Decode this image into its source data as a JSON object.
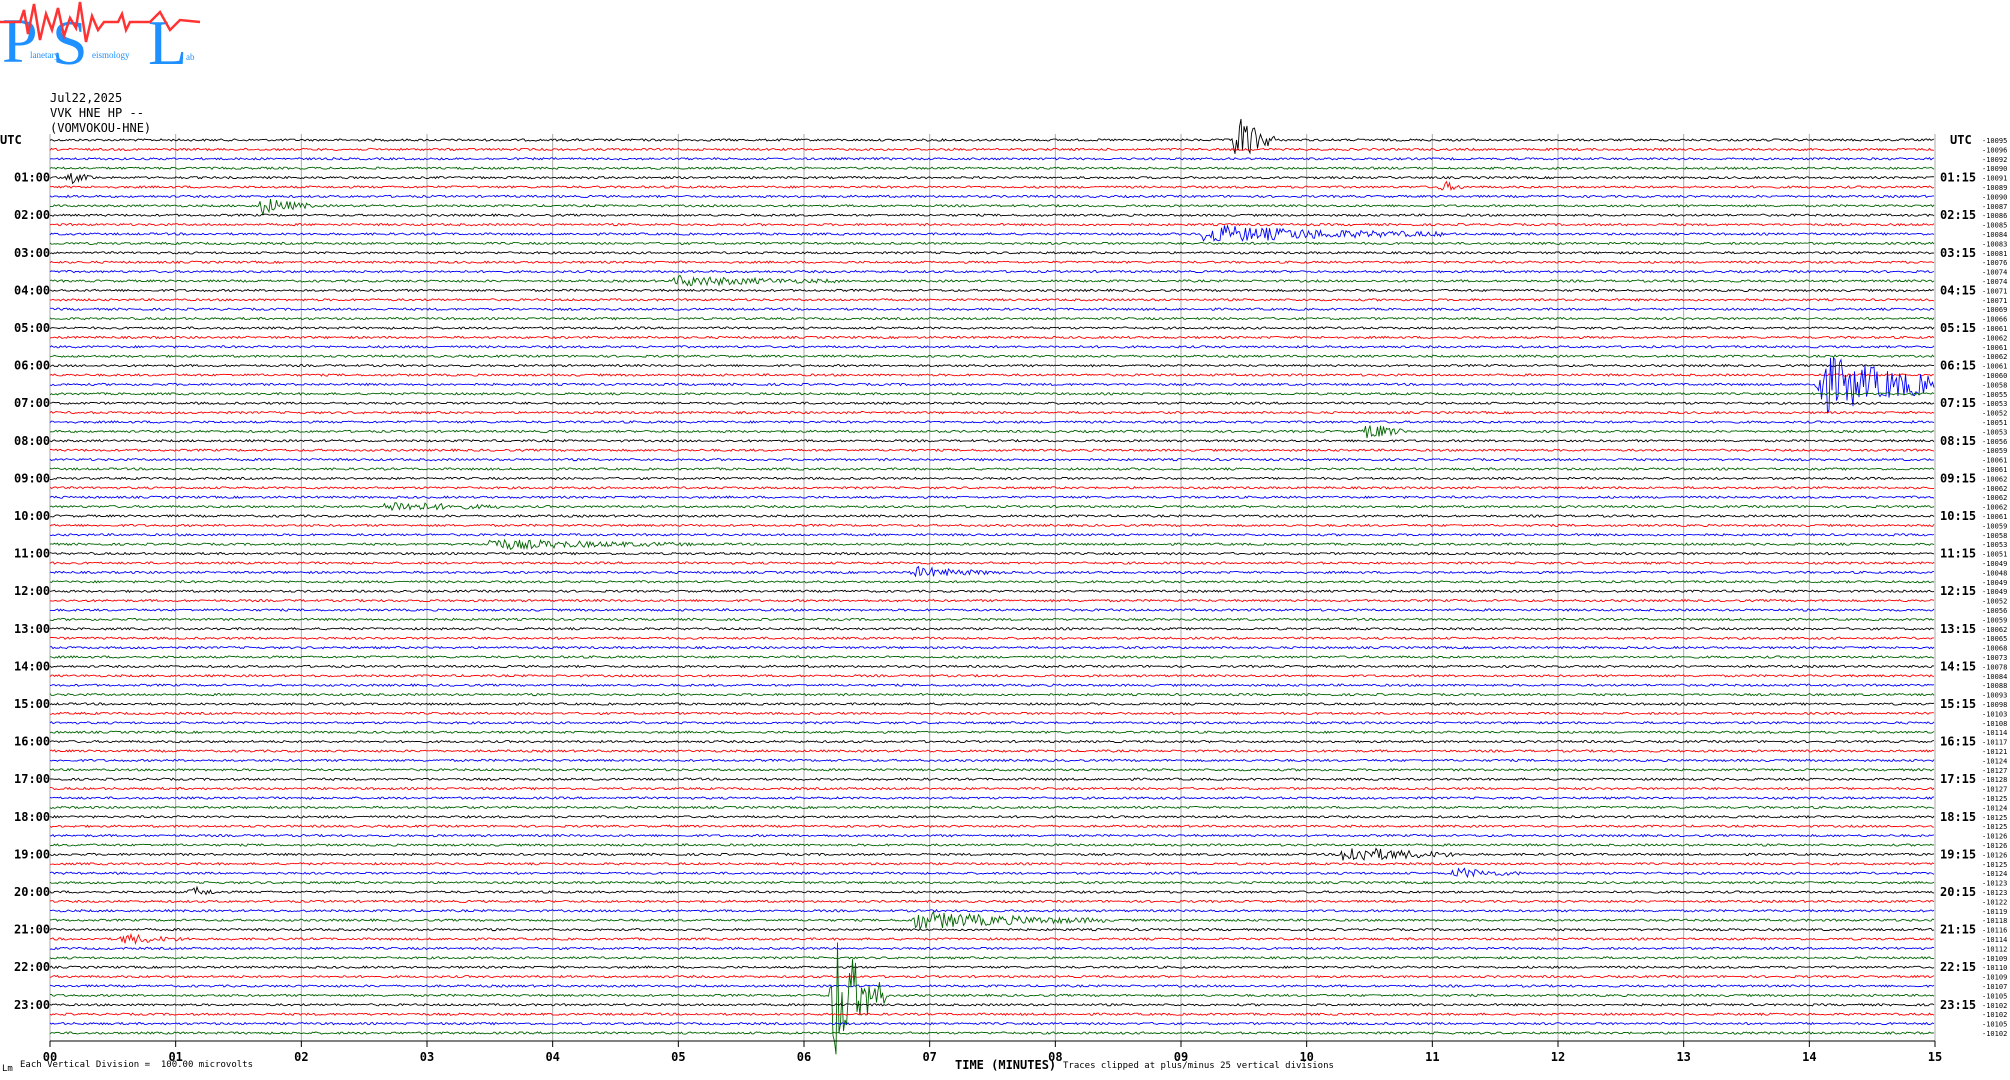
{
  "logo": {
    "letters": [
      "P",
      "S",
      "L"
    ],
    "words": [
      "lanetary",
      "eismology",
      "ab"
    ]
  },
  "header": {
    "date": "Jul22,2025",
    "station": "VVK HNE HP --",
    "channel": "(VOMVOKOU-HNE)"
  },
  "footer": {
    "corner_mark": "Lm",
    "division_note": "Each Vertical Division =  100.00 microvolts",
    "xlabel": "TIME (MINUTES)",
    "clip_note": "Traces clipped at plus/minus 25 vertical divisions"
  },
  "colors": {
    "series": [
      "#000000",
      "#ff0000",
      "#0000ff",
      "#006400"
    ],
    "grid": "#a9a9a9"
  },
  "chart_data": {
    "type": "line",
    "description_free": true,
    "xlabel": "TIME (MINUTES)",
    "x_ticks": [
      "00",
      "01",
      "02",
      "03",
      "04",
      "05",
      "06",
      "07",
      "08",
      "09",
      "10",
      "11",
      "12",
      "13",
      "14",
      "15"
    ],
    "xlim": [
      0,
      15
    ],
    "left_tz": "UTC",
    "right_tz": "UTC",
    "left_labels": [
      "01:00",
      "02:00",
      "03:00",
      "04:00",
      "05:00",
      "06:00",
      "07:00",
      "08:00",
      "09:00",
      "10:00",
      "11:00",
      "12:00",
      "13:00",
      "14:00",
      "15:00",
      "16:00",
      "17:00",
      "18:00",
      "19:00",
      "20:00",
      "21:00",
      "22:00",
      "23:00"
    ],
    "right_labels": [
      "01:15",
      "02:15",
      "03:15",
      "04:15",
      "05:15",
      "06:15",
      "07:15",
      "08:15",
      "09:15",
      "10:15",
      "11:15",
      "12:15",
      "13:15",
      "14:15",
      "15:15",
      "16:15",
      "17:15",
      "18:15",
      "19:15",
      "20:15",
      "21:15",
      "22:15",
      "23:15"
    ],
    "trace_count": 96,
    "trace_minutes": 15,
    "color_cycle": [
      "black",
      "red",
      "blue",
      "green"
    ],
    "trace_offsets": [
      "-10095",
      "-10096",
      "-10092",
      "-10090",
      "-10091",
      "-10089",
      "-10090",
      "-10087",
      "-10086",
      "-10085",
      "-10084",
      "-10083",
      "-10081",
      "-10076",
      "-10074",
      "-10074",
      "-10071",
      "-10071",
      "-10069",
      "-10066",
      "-10061",
      "-10062",
      "-10061",
      "-10062",
      "-10061",
      "-10060",
      "-10058",
      "-10055",
      "-10053",
      "-10052",
      "-10051",
      "-10053",
      "-10056",
      "-10059",
      "-10061",
      "-10061",
      "-10062",
      "-10062",
      "-10062",
      "-10062",
      "-10061",
      "-10059",
      "-10058",
      "-10053",
      "-10051",
      "-10049",
      "-10048",
      "-10049",
      "-10049",
      "-10052",
      "-10056",
      "-10059",
      "-10062",
      "-10065",
      "-10068",
      "-10073",
      "-10078",
      "-10084",
      "-10088",
      "-10093",
      "-10098",
      "-10103",
      "-10108",
      "-10114",
      "-10117",
      "-10121",
      "-10124",
      "-10127",
      "-10128",
      "-10127",
      "-10125",
      "-10124",
      "-10125",
      "-10125",
      "-10126",
      "-10126",
      "-10126",
      "-10125",
      "-10124",
      "-10123",
      "-10123",
      "-10122",
      "-10119",
      "-10118",
      "-10116",
      "-10114",
      "-10112",
      "-10109",
      "-10110",
      "-10109",
      "-10107",
      "-10105",
      "-10102",
      "-10102",
      "-10105",
      "-10102"
    ],
    "events": [
      {
        "trace": 0,
        "minute": 9.45,
        "amplitude": "large",
        "duration_min": 0.2
      },
      {
        "trace": 4,
        "minute": 0.18,
        "amplitude": "small",
        "duration_min": 0.1
      },
      {
        "trace": 5,
        "minute": 11.1,
        "amplitude": "small",
        "duration_min": 0.05
      },
      {
        "trace": 7,
        "minute": 1.7,
        "amplitude": "medium",
        "duration_min": 0.3
      },
      {
        "trace": 10,
        "minute": 9.2,
        "amplitude": "medium",
        "duration_min": 1.8
      },
      {
        "trace": 15,
        "minute": 5.0,
        "amplitude": "small",
        "duration_min": 1.2
      },
      {
        "trace": 26,
        "minute": 14.1,
        "amplitude": "very_large",
        "duration_min": 1.3
      },
      {
        "trace": 31,
        "minute": 10.5,
        "amplitude": "medium",
        "duration_min": 0.2
      },
      {
        "trace": 39,
        "minute": 2.7,
        "amplitude": "small",
        "duration_min": 0.8
      },
      {
        "trace": 43,
        "minute": 3.5,
        "amplitude": "small",
        "duration_min": 1.5
      },
      {
        "trace": 46,
        "minute": 6.9,
        "amplitude": "small",
        "duration_min": 0.6
      },
      {
        "trace": 76,
        "minute": 10.3,
        "amplitude": "medium",
        "duration_min": 0.8
      },
      {
        "trace": 78,
        "minute": 11.2,
        "amplitude": "small",
        "duration_min": 0.4
      },
      {
        "trace": 80,
        "minute": 1.15,
        "amplitude": "small",
        "duration_min": 0.1
      },
      {
        "trace": 83,
        "minute": 6.9,
        "amplitude": "medium",
        "duration_min": 1.4
      },
      {
        "trace": 85,
        "minute": 0.6,
        "amplitude": "small",
        "duration_min": 0.4
      },
      {
        "trace": 91,
        "minute": 6.25,
        "amplitude": "clipped",
        "duration_min": 0.3
      }
    ]
  }
}
